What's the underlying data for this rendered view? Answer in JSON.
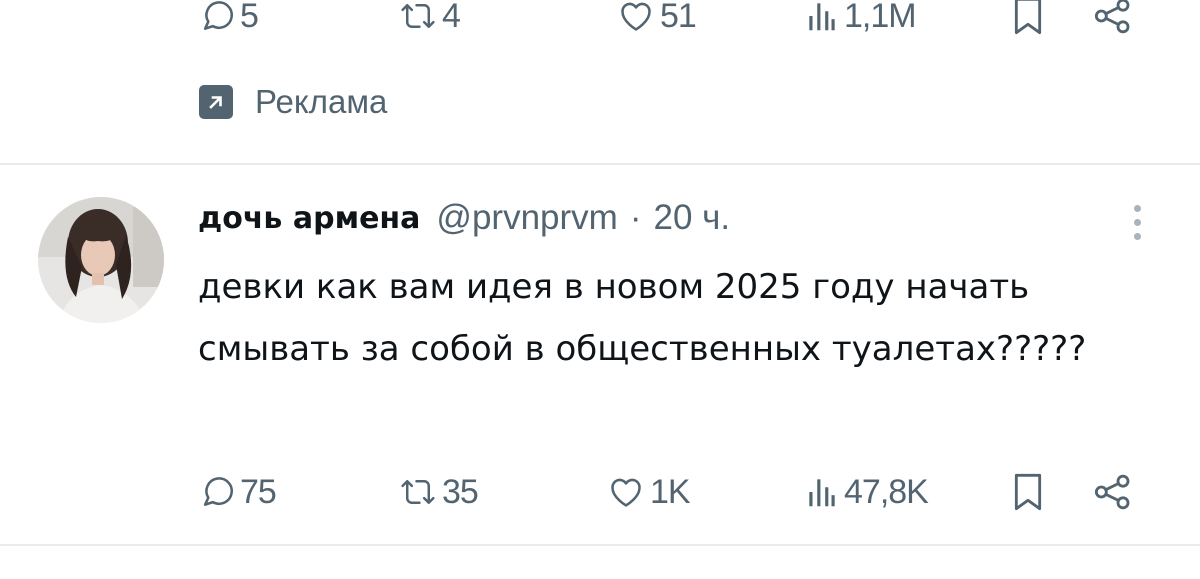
{
  "prev_post": {
    "actions": {
      "reply_count": "5",
      "repost_count": "4",
      "like_count": "51",
      "view_count": "1,1M"
    },
    "ad_label": "Реклама"
  },
  "post": {
    "author_name": "дочь армена",
    "handle": "@prvnprvm",
    "separator": "·",
    "time": "20 ч.",
    "text": "девки как вам идея в новом 2025 году начать смывать за собой в общественных туалетах?????",
    "actions": {
      "reply_count": "75",
      "repost_count": "35",
      "like_count": "1K",
      "view_count": "47,8K"
    }
  },
  "colors": {
    "text_primary": "#0f1419",
    "text_secondary": "#536471",
    "divider": "#e9ecef",
    "background": "#ffffff"
  },
  "icons": [
    "reply-icon",
    "repost-icon",
    "like-icon",
    "views-icon",
    "bookmark-icon",
    "share-icon",
    "promoted-icon",
    "more-icon"
  ]
}
